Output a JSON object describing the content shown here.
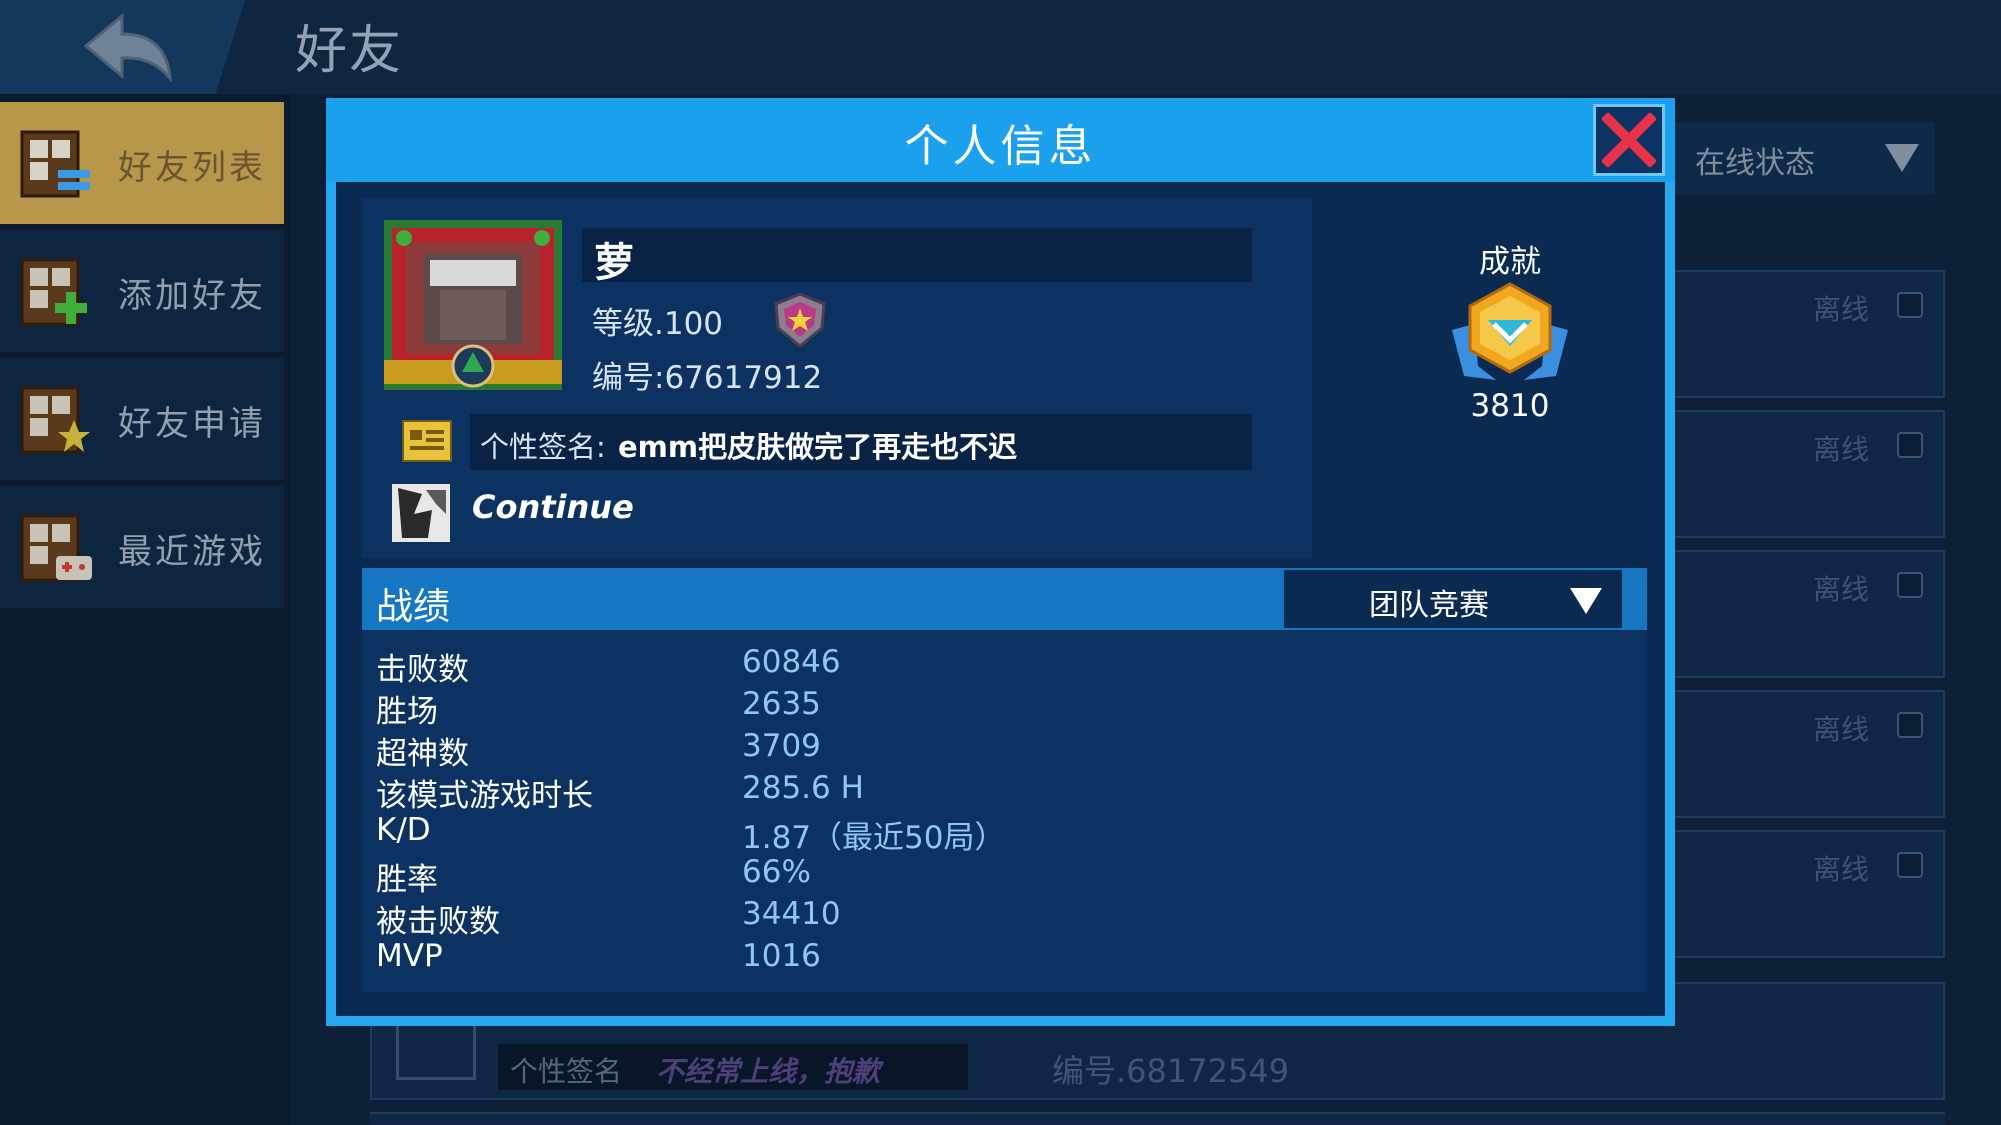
{
  "page": {
    "title": "好友"
  },
  "sidebar": {
    "items": [
      {
        "label": "好友列表",
        "active": true
      },
      {
        "label": "添加好友",
        "active": false
      },
      {
        "label": "好友申请",
        "active": false
      },
      {
        "label": "最近游戏",
        "active": false
      }
    ]
  },
  "filter": {
    "label": "在线状态"
  },
  "friend_list": {
    "offline_label": "离线",
    "bottom_entry": {
      "signature_label": "个性签名",
      "signature_text": "不经常上线，抱歉",
      "id_text": "编号.68172549"
    }
  },
  "modal": {
    "title": "个人信息",
    "profile": {
      "name": "萝",
      "level": "等级.100",
      "id": "编号:67617912",
      "signature_label": "个性签名:",
      "signature_text": "emm把皮肤做完了再走也不迟",
      "title_text": "Continue"
    },
    "achievement": {
      "label": "成就",
      "count": "3810"
    },
    "stats": {
      "header": "战绩",
      "mode": "团队竞赛",
      "rows": [
        {
          "label": "击败数",
          "value": "60846"
        },
        {
          "label": "胜场",
          "value": "2635"
        },
        {
          "label": "超神数",
          "value": "3709"
        },
        {
          "label": "该模式游戏时长",
          "value": "285.6 H"
        },
        {
          "label": "K/D",
          "value": "1.87（最近50局）"
        },
        {
          "label": "胜率",
          "value": "66%"
        },
        {
          "label": "被击败数",
          "value": "34410"
        },
        {
          "label": "MVP",
          "value": "1016"
        }
      ]
    }
  },
  "colors": {
    "modal_border": "#25a8f0",
    "modal_header": "#1aa0ec",
    "stats_header": "#1676c2",
    "stat_value": "#8fc7ef",
    "close_x": "#e8324a",
    "sidebar_active": "#b9974a"
  },
  "icons": {
    "back": "back-arrow-icon",
    "close": "close-x-icon",
    "dropdown": "triangle-down-icon",
    "rank": "rank-shield-icon",
    "achievement": "achievement-trophy-icon",
    "signature": "id-card-icon"
  }
}
